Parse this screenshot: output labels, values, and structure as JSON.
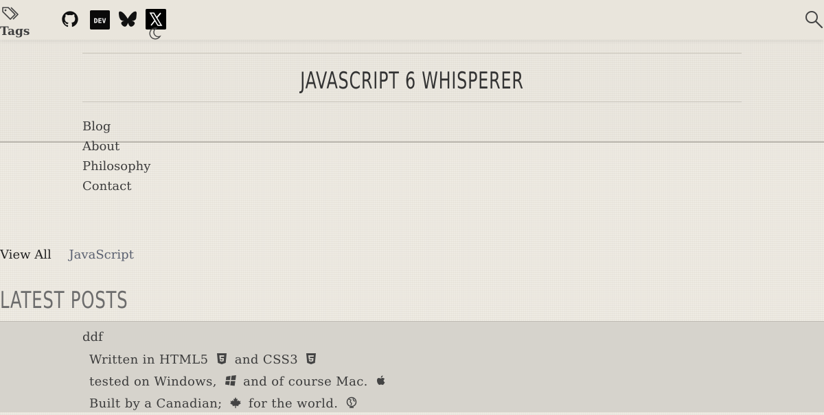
{
  "topbar": {
    "tags_label": "Tags",
    "social_icons": [
      "github-icon",
      "dev-icon",
      "bluesky-icon",
      "x-icon"
    ],
    "dev_label": "DEV"
  },
  "header": {
    "title": "JavaScript 6 Whisperer"
  },
  "nav": {
    "items": [
      "Blog",
      "About",
      "Philosophy",
      "Contact"
    ]
  },
  "filters": {
    "all": "View All",
    "javascript": "JavaScript"
  },
  "section": {
    "heading": "Latest Posts"
  },
  "posts": [
    {
      "title": "ddf"
    }
  ],
  "footer": {
    "line1_a": "Written in HTML5",
    "line1_b": "and CSS3",
    "line2_a": "tested on Windows,",
    "line2_b": "and of course Mac.",
    "line3_a": "Built by a Canadian;",
    "line3_b": "for the world."
  }
}
